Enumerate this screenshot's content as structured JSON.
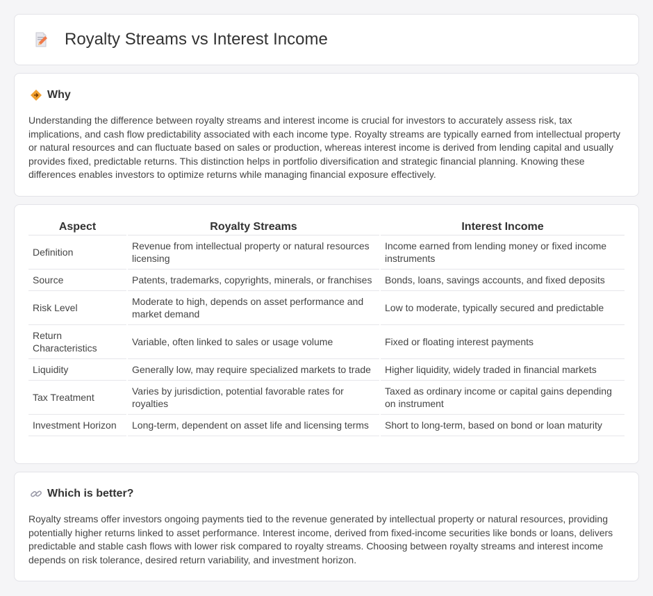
{
  "header": {
    "title": "Royalty Streams vs Interest Income",
    "icon": "document-pencil-icon"
  },
  "why": {
    "title": "Why",
    "icon": "diamond-arrow-icon",
    "text": "Understanding the difference between royalty streams and interest income is crucial for investors to accurately assess risk, tax implications, and cash flow predictability associated with each income type. Royalty streams are typically earned from intellectual property or natural resources and can fluctuate based on sales or production, whereas interest income is derived from lending capital and usually provides fixed, predictable returns. This distinction helps in portfolio diversification and strategic financial planning. Knowing these differences enables investors to optimize returns while managing financial exposure effectively."
  },
  "table": {
    "headers": [
      "Aspect",
      "Royalty Streams",
      "Interest Income"
    ],
    "rows": [
      [
        "Definition",
        "Revenue from intellectual property or natural resources licensing",
        "Income earned from lending money or fixed income instruments"
      ],
      [
        "Source",
        "Patents, trademarks, copyrights, minerals, or franchises",
        "Bonds, loans, savings accounts, and fixed deposits"
      ],
      [
        "Risk Level",
        "Moderate to high, depends on asset performance and market demand",
        "Low to moderate, typically secured and predictable"
      ],
      [
        "Return Characteristics",
        "Variable, often linked to sales or usage volume",
        "Fixed or floating interest payments"
      ],
      [
        "Liquidity",
        "Generally low, may require specialized markets to trade",
        "Higher liquidity, widely traded in financial markets"
      ],
      [
        "Tax Treatment",
        "Varies by jurisdiction, potential favorable rates for royalties",
        "Taxed as ordinary income or capital gains depending on instrument"
      ],
      [
        "Investment Horizon",
        "Long-term, dependent on asset life and licensing terms",
        "Short to long-term, based on bond or loan maturity"
      ]
    ]
  },
  "which": {
    "title": "Which is better?",
    "icon": "link-icon",
    "text": "Royalty streams offer investors ongoing payments tied to the revenue generated by intellectual property or natural resources, providing potentially higher returns linked to asset performance. Interest income, derived from fixed-income securities like bonds or loans, delivers predictable and stable cash flows with lower risk compared to royalty streams. Choosing between royalty streams and interest income depends on risk tolerance, desired return variability, and investment horizon."
  },
  "colors": {
    "accent_orange": "#f0a030",
    "page_bg": "#f5f5f7",
    "card_border": "#e3e3e8"
  }
}
